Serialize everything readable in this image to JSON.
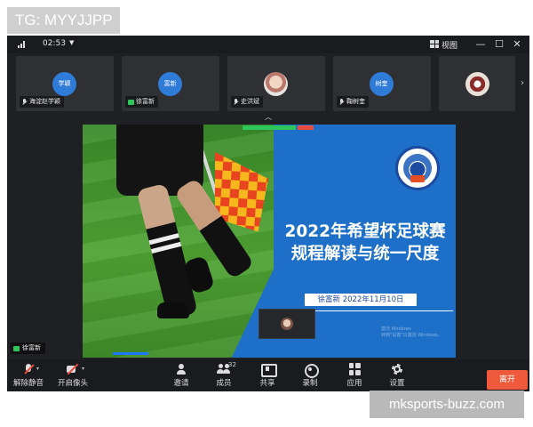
{
  "watermark_top": "TG: MYYJJPP",
  "watermark_bottom": "mksports-buzz.com",
  "titlebar": {
    "time": "02:53",
    "view_label": "视图",
    "minimize_icon": "minimize-icon",
    "maximize_icon": "maximize-icon",
    "close_icon": "close-icon"
  },
  "participants": [
    {
      "avatar_text": "学颖",
      "name": "海淀赵学颖",
      "avatar_type": "initials",
      "status_icon": "mic-muted-icon"
    },
    {
      "avatar_text": "富新",
      "name": "徐富新",
      "avatar_type": "initials",
      "status_icon": "camera-on-icon"
    },
    {
      "avatar_text": "",
      "name": "史洪斌",
      "avatar_type": "photo",
      "status_icon": "mic-muted-icon"
    },
    {
      "avatar_text": "树奎",
      "name": "鞠树奎",
      "avatar_type": "initials",
      "status_icon": "mic-muted-icon"
    },
    {
      "avatar_text": "",
      "name": "",
      "avatar_type": "photo",
      "status_icon": ""
    }
  ],
  "slide": {
    "title_line1": "2022年希望杯足球赛",
    "title_line2": "规程解读与统一尺度",
    "presenter_date": "徐富新  2022年11月10日",
    "windows_activate_line1": "激活 Windows",
    "windows_activate_line2": "转到\"设置\"以激活 Windows。"
  },
  "active_speaker": "徐富新",
  "toolbar": {
    "mute_label": "解除静音",
    "camera_label": "开启像头",
    "invite_label": "邀请",
    "members_label": "成员",
    "members_count": "32",
    "share_label": "共享",
    "record_label": "录制",
    "apps_label": "应用",
    "settings_label": "设置",
    "leave_label": "离开"
  },
  "colors": {
    "window_bg": "#1f2023",
    "avatar_blue": "#2f7bd8",
    "slide_blue": "#1d6fc8",
    "leave_red": "#f05a3c"
  }
}
